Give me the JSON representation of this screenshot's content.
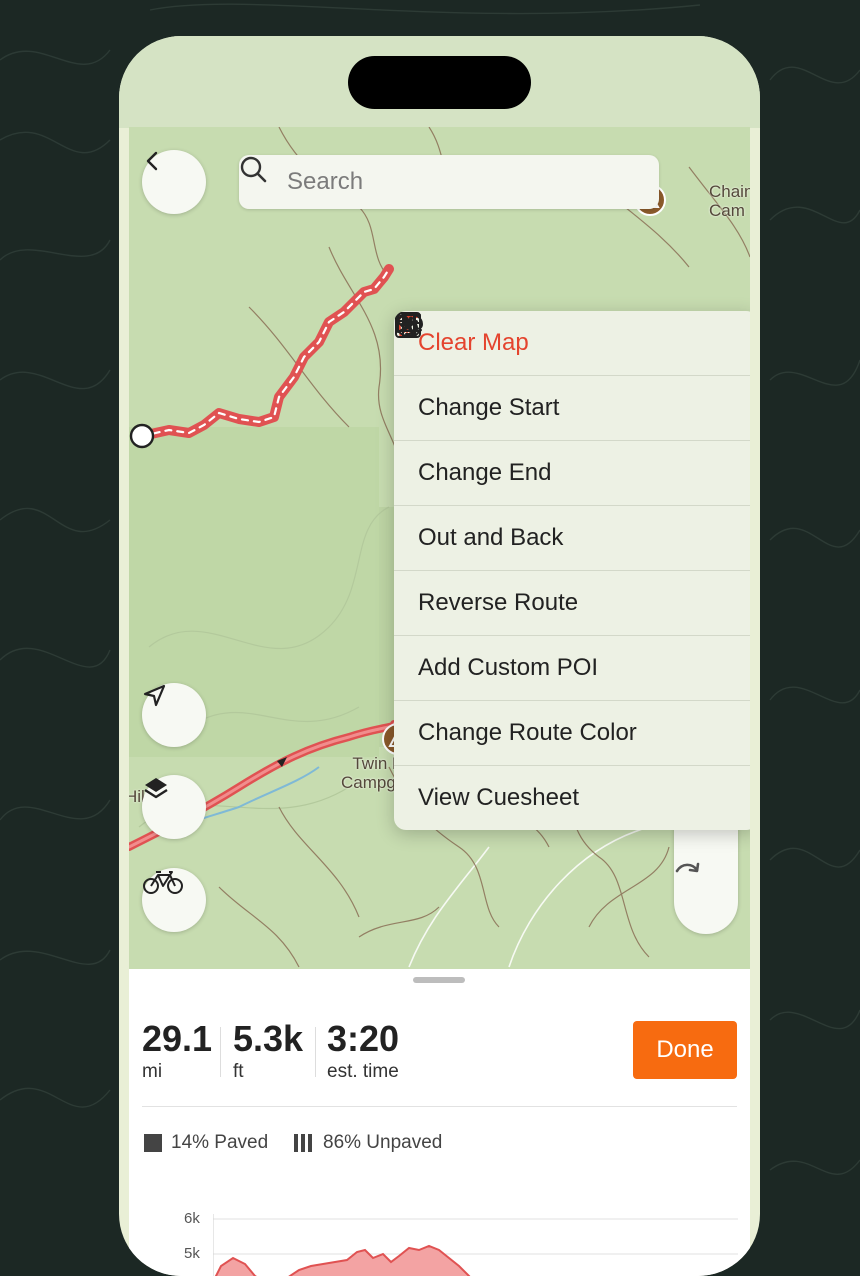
{
  "map": {
    "search_placeholder": "Search",
    "labels": {
      "campground": "Twin Falls\nCampground",
      "hill_fragment": "Hill",
      "top_right_fragment": "Chain\nCam"
    }
  },
  "menu": {
    "items": [
      {
        "label": "Clear Map",
        "icon": "trash-icon",
        "destructive": true
      },
      {
        "label": "Change Start",
        "icon": "play-icon"
      },
      {
        "label": "Change End",
        "icon": "stop-icon"
      },
      {
        "label": "Out and Back",
        "icon": "arrows-up-down-icon"
      },
      {
        "label": "Reverse Route",
        "icon": "reverse-arrow-icon"
      },
      {
        "label": "Add Custom POI",
        "icon": "star-square-icon"
      },
      {
        "label": "Change Route Color",
        "icon": "palette-icon"
      },
      {
        "label": "View Cuesheet",
        "icon": "list-icon"
      }
    ]
  },
  "stats": {
    "distance": {
      "value": "29.1",
      "unit": "mi"
    },
    "elevation": {
      "value": "5.3k",
      "unit": "ft"
    },
    "time": {
      "value": "3:20",
      "unit": "est. time"
    },
    "done_label": "Done"
  },
  "surface": {
    "paved": "14% Paved",
    "unpaved": "86% Unpaved"
  },
  "elevation_chart": {
    "ticks": [
      "6k",
      "5k"
    ]
  },
  "colors": {
    "accent": "#f76b10",
    "destructive": "#e4442e",
    "route": "#e85c5c",
    "background": "#1c2824"
  }
}
